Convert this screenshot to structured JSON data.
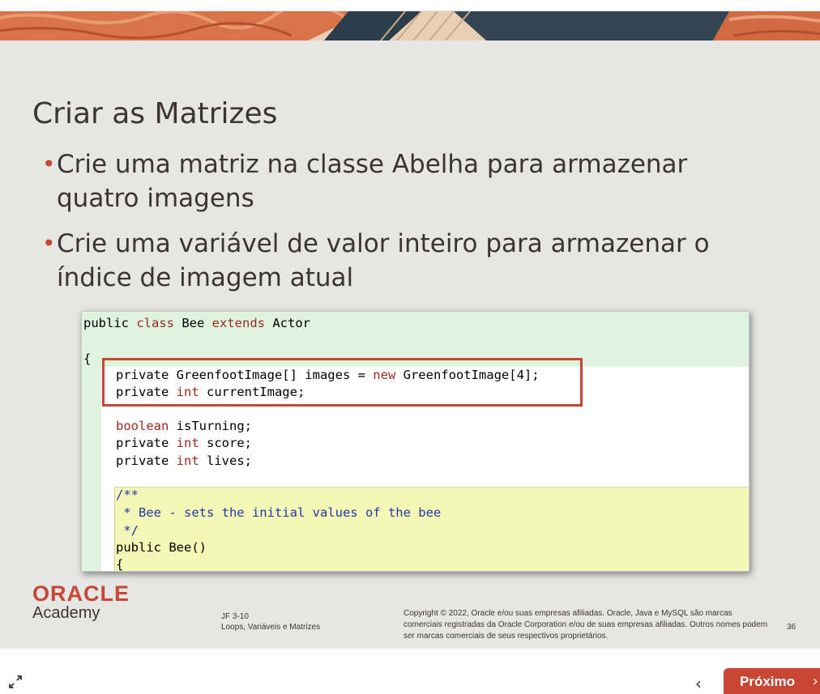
{
  "slide": {
    "title": "Criar as Matrizes",
    "bullets": [
      "Crie uma matriz na classe Abelha para armazenar quatro imagens",
      "Crie uma variável de valor inteiro para armazenar o índice de imagem atual"
    ]
  },
  "code": {
    "line1": {
      "a": "public ",
      "kw1": "class",
      "b": " Bee ",
      "kw2": "extends",
      "c": " Actor"
    },
    "line2": "{",
    "line3": {
      "a": "private GreenfootImage[] images = ",
      "kw": "new",
      "b": " GreenfootImage[4];"
    },
    "line4": {
      "a": "private ",
      "kw": "int",
      "b": " currentImage;"
    },
    "line5": {
      "kw": "boolean",
      "b": " isTurning;"
    },
    "line6": {
      "a": "private ",
      "kw": "int",
      "b": " score;"
    },
    "line7": {
      "a": "private ",
      "kw": "int",
      "b": " lives;"
    },
    "line8": "/**",
    "line9": " * Bee - sets the initial values of the bee",
    "line10": " */",
    "line11": "public Bee()",
    "line12": "{"
  },
  "footer": {
    "logo": "ORACLE",
    "academy": "Academy",
    "course_code": "JF 3-10",
    "course_title": "Loops, Variáveis e Matrizes",
    "copyright": "Copyright © 2022, Oracle e/ou suas empresas afiliadas. Oracle, Java e MySQL são marcas comerciais registradas da Oracle Corporation e/ou de suas empresas afiliadas. Outros nomes podem ser marcas comerciais de seus respectivos proprietários.",
    "page_number": "36"
  },
  "nav": {
    "prev_icon": "‹",
    "next_label": "Próximo",
    "next_icon": "›",
    "fullscreen_icon": "expand-icon"
  },
  "colors": {
    "accent": "#c74634",
    "slide_bg": "#e6e7e5",
    "text": "#3b3431",
    "code_green": "#dff3df",
    "code_yellow": "#f4f7b5"
  }
}
